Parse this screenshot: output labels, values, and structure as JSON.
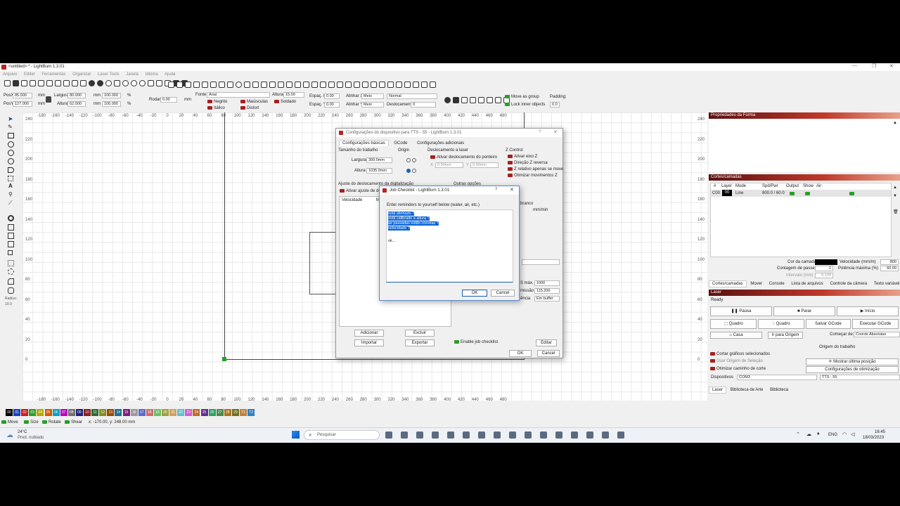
{
  "window": {
    "title": "<untitled> * - LightBurn 1.3.01"
  },
  "menu": [
    "Arquivo",
    "Editar",
    "Ferramentas",
    "Organizar",
    "Laser Tools",
    "Janela",
    "Idioma",
    "Ajuda"
  ],
  "props": {
    "posx_label": "PosX",
    "posx": "85.000",
    "posy_label": "PosY",
    "posy": "127.000",
    "mm": "mm",
    "largura_label": "Largura",
    "largura": "80.000",
    "altura_label": "Altura",
    "altura": "62.000",
    "pct1": "100.000",
    "pct2": "100.000",
    "pct_sym": "%",
    "rodar_label": "Rodar",
    "rodar": "0.00",
    "fonte_label": "Fonte",
    "fonte": "Arial",
    "altura_txt_label": "Altura",
    "altura_txt": "15.00",
    "espac_h_label": "Espaç. H",
    "espac_h": "0.00",
    "espac_v_label": "Espaç. V",
    "espac_v": "0.00",
    "alinhar_x": "Alinhar X",
    "alinhar_x_val": "Meio",
    "alinhar_y": "Alinhar Y",
    "alinhar_y_val": "Meio",
    "normal": "Normal",
    "deslocamento_label": "Deslocamento",
    "deslocamento": "0",
    "negrito": "Negrito",
    "italico": "Itálico",
    "maiusculas": "Maiúsculas",
    "distort": "Distort",
    "soldado": "Soldado",
    "move_as_group": "Move as group",
    "lock_inner": "Lock inner objects",
    "padding_label": "Padding:",
    "padding": "0.0"
  },
  "ruler_x": [
    "-180",
    "-160",
    "-140",
    "-120",
    "-100",
    "-80",
    "-60",
    "-40",
    "-20",
    "0",
    "20",
    "40",
    "60",
    "80",
    "100",
    "120",
    "140",
    "160",
    "180",
    "200",
    "220",
    "240",
    "260",
    "280",
    "300",
    "320",
    "340",
    "360",
    "380",
    "400",
    "420",
    "440",
    "460",
    "480"
  ],
  "ruler_y": [
    "240",
    "220",
    "200",
    "180",
    "160",
    "140",
    "120",
    "100",
    "80",
    "60",
    "40",
    "20",
    "0"
  ],
  "left_tools": {
    "radius_label": "Radius:",
    "radius": "10.0"
  },
  "device_dialog": {
    "title": "Configurações do dispositivo para TTS - 55 - LightBurn 1.3.01",
    "tabs": [
      "Configurações básicas",
      "GCode",
      "Configurações adicionais"
    ],
    "tamanho": "Tamanho do trabalho",
    "largura_label": "Largura",
    "largura": "300.0mm",
    "altura_label": "Altura",
    "altura": "1035.0mm",
    "origin": "Origin",
    "deslocamento_laser": "Deslocamento a laser",
    "ativar_desloc": "Ativar deslocamento do ponteiro",
    "x_label": "X",
    "x_val": "0.00mm",
    "y_label": "Y",
    "y_val": "0.00mm",
    "zcontrol": "Z Control",
    "ativar_z": "Ativar eixo Z",
    "direcao_z": "Direção Z reversa",
    "z_relativo": "Z relativo apenas se move",
    "otimizar_z": "Otimizar movimentos Z",
    "ajuste_scan": "Ajuste do deslocamento da digitalização",
    "ativar_ajuste": "Ativar ajuste de des",
    "outras": "Outras opções",
    "velocidade_col": "Velocidade",
    "mu_col": "Mu",
    "branco": "branco",
    "mmmin": "mm/min",
    "s_max_label": "S máx.",
    "s_max": "1000",
    "missao_label": "missão",
    "missao": "115.200",
    "encia_label": "ência",
    "encia": "Em buffer",
    "adicionar": "Adicionar",
    "excluir": "Excluir",
    "importar": "Importar",
    "exportar": "Exportar",
    "enable_checklist": "Enable job checklist",
    "editar": "Editar",
    "ok": "OK",
    "cancel": "Cancel"
  },
  "checklist_dialog": {
    "title": "Job Checklist - LightBurn 1.3.01",
    "prompt": "Enter reminders to yourself below (water, air, etc.)",
    "lines": [
      "está alinhado ?",
      "está calibrado a altura ?",
      "as passadas estão corretas ?",
      "velocidade ?"
    ],
    "last": "ok...",
    "ok": "OK",
    "cancel": "Cancel"
  },
  "shape_props": {
    "title": "Propriedades da Forma"
  },
  "cuts": {
    "title": "Cortes/camadas",
    "headers": [
      "#",
      "Layer",
      "Mode",
      "Spd/Pwr",
      "Output",
      "Show",
      "Air"
    ],
    "row": {
      "num": "C00",
      "layer": "00",
      "mode": "Line",
      "spdpwr": "800.0 / 60.0"
    },
    "cor_label": "Cor da camada",
    "vel_label": "Velocidade (mm/m)",
    "vel": "800",
    "passes_label": "Contagem de passes",
    "passes": "1",
    "pot_label": "Potência máxima (%)",
    "pot": "60.00",
    "intervalo_label": "Intervalo (mm)",
    "intervalo": "0.100",
    "tabs": [
      "Cortes/camadas",
      "Mover",
      "Console",
      "Lista de arquivos",
      "Controle da câmera",
      "Texto variável"
    ]
  },
  "laser": {
    "title": "Laser",
    "status": "Ready",
    "pausa": "Pausa",
    "parar": "Parar",
    "inicio": "Início",
    "quadro1": "Quadro",
    "quadro2": "Quadro",
    "salvar": "Salvar GCode",
    "executar": "Executar GCode",
    "casa": "Casa",
    "ir_origem": "Ir para Origem",
    "comecar_label": "Começar de:",
    "comecar": "Coords Absolutas",
    "origem_label": "Origem do trabalho",
    "cortar_sel": "Cortar gráficos selecionados",
    "usar_origem": "Usar Origem de Seleção",
    "otimizar_caminho": "Otimizar caminho de corte",
    "mostrar_pos": "Mostrar última posição",
    "config_otim": "Configurações de otimização",
    "dispositivos_label": "Dispositivos",
    "porta": "COM3",
    "device": "TTS - 55",
    "tabs": [
      "Laser",
      "Biblioteca de Arte",
      "Biblioteca"
    ]
  },
  "palette": [
    "00",
    "01",
    "02",
    "03",
    "04",
    "05",
    "06",
    "07",
    "08",
    "09",
    "10",
    "11",
    "12",
    "13",
    "14",
    "15",
    "16",
    "17",
    "18",
    "19",
    "20",
    "21",
    "22",
    "23",
    "24",
    "25",
    "26",
    "27",
    "28",
    "29",
    "T1",
    "T2"
  ],
  "palette_colors": [
    "#000000",
    "#1f3fbf",
    "#c81e1e",
    "#2a9d2a",
    "#b8a600",
    "#d45a00",
    "#00a0c0",
    "#c000c0",
    "#707070",
    "#20207a",
    "#8a1e1e",
    "#2e6d2e",
    "#8a8a20",
    "#9a4a00",
    "#207090",
    "#7a207a",
    "#9a9a9a",
    "#5a6ad0",
    "#d06a6a",
    "#6ac06a",
    "#a0a040",
    "#d0a060",
    "#60c0d0",
    "#d060d0",
    "#c06a30",
    "#603090",
    "#30a060",
    "#4a8a4a",
    "#b07020",
    "#707020",
    "#c08040",
    "#3080c0"
  ],
  "status_bar": {
    "move": "Move",
    "size": "Size",
    "rotate": "Rotate",
    "shear": "Shear",
    "coords": "x: -170.00, y: 248.00 mm"
  },
  "taskbar": {
    "temp": "24°C",
    "weather": "Pred. nublado",
    "search": "Pesquisar",
    "lang": "ENG",
    "time": "16:45",
    "date": "18/03/2023"
  }
}
